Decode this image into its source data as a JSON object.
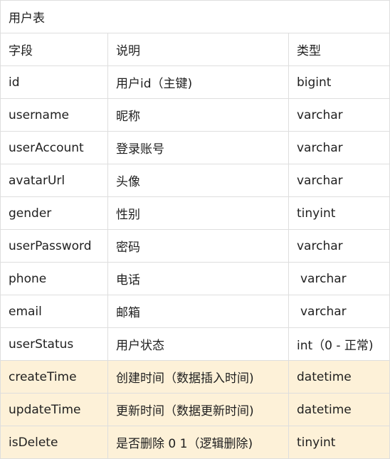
{
  "table": {
    "title": "用户表",
    "headers": [
      "字段",
      "说明",
      "类型"
    ],
    "rows": [
      {
        "field": "id",
        "desc": "用户id（主键)",
        "type": "bigint",
        "highlight": false
      },
      {
        "field": "username",
        "desc": "昵称",
        "type": "varchar",
        "highlight": false
      },
      {
        "field": "userAccount",
        "desc": "登录账号",
        "type": "varchar",
        "highlight": false
      },
      {
        "field": "avatarUrl",
        "desc": "头像",
        "type": "varchar",
        "highlight": false
      },
      {
        "field": "gender",
        "desc": "性别",
        "type": "tinyint",
        "highlight": false
      },
      {
        "field": "userPassword",
        "desc": "密码",
        "type": "varchar",
        "highlight": false
      },
      {
        "field": "phone",
        "desc": "电话",
        "type": "varchar",
        "highlight": false
      },
      {
        "field": "email",
        "desc": "邮箱",
        "type": "varchar",
        "highlight": false
      },
      {
        "field": "userStatus",
        "desc": "用户状态",
        "type": "int（0 - 正常)",
        "highlight": false
      },
      {
        "field": "createTime",
        "desc": "创建时间（数据插入时间)",
        "type": "datetime",
        "highlight": true
      },
      {
        "field": "updateTime",
        "desc": "更新时间（数据更新时间)",
        "type": "datetime",
        "highlight": true
      },
      {
        "field": "isDelete",
        "desc": "是否删除 0 1（逻辑删除)",
        "type": "tinyint",
        "highlight": true
      }
    ]
  },
  "colors": {
    "highlight_bg": "#fdf1d8",
    "border": "#dedede",
    "text": "#1f1f1f"
  }
}
